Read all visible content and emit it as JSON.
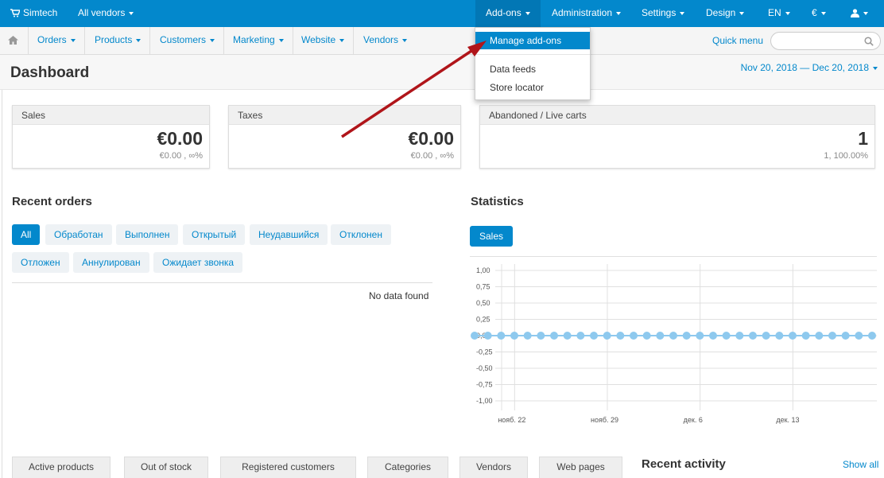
{
  "topbar": {
    "store": "Simtech",
    "vendors": "All vendors",
    "menu": [
      "Add-ons",
      "Administration",
      "Settings",
      "Design",
      "EN",
      "€"
    ]
  },
  "dropdown": {
    "items": [
      "Manage add-ons",
      "Data feeds",
      "Store locator"
    ]
  },
  "subnav": {
    "items": [
      "Orders",
      "Products",
      "Customers",
      "Marketing",
      "Website",
      "Vendors"
    ],
    "quick_menu": "Quick menu"
  },
  "page": {
    "title": "Dashboard",
    "date_range": "Nov 20, 2018 — Dec 20, 2018"
  },
  "cards": [
    {
      "label": "Sales",
      "value": "€0.00",
      "sub": "€0.00 , ∞%"
    },
    {
      "label": "Taxes",
      "value": "€0.00",
      "sub": "€0.00 , ∞%"
    },
    {
      "label": "Abandoned / Live carts",
      "value": "1",
      "sub": "1, 100.00%"
    }
  ],
  "recent_orders": {
    "title": "Recent orders",
    "filters_row1": [
      "All",
      "Обработан",
      "Выполнен",
      "Открытый",
      "Неудавшийся",
      "Отклонен"
    ],
    "filters_row2": [
      "Отложен",
      "Аннулирован",
      "Ожидает звонка"
    ],
    "empty": "No data found"
  },
  "statistics": {
    "title": "Statistics",
    "tab": "Sales"
  },
  "chart_data": {
    "type": "line",
    "title": "",
    "y_ticks": [
      "1,00",
      "0,75",
      "0,50",
      "0,25",
      "0,00",
      "-0,25",
      "-0,50",
      "-0,75",
      "-1,00"
    ],
    "x_ticks": [
      "нояб. 22",
      "нояб. 29",
      "дек. 6",
      "дек. 13"
    ],
    "ylim": [
      -1,
      1
    ],
    "series": [
      {
        "values": [
          0,
          0,
          0,
          0,
          0,
          0,
          0,
          0,
          0,
          0,
          0,
          0,
          0,
          0,
          0,
          0,
          0,
          0,
          0,
          0,
          0,
          0,
          0,
          0,
          0,
          0,
          0,
          0,
          0,
          0,
          0
        ]
      }
    ],
    "color": "#8ec9ee"
  },
  "bottom_tabs": [
    "Active products",
    "Out of stock",
    "Registered customers",
    "Categories",
    "Vendors",
    "Web pages"
  ],
  "recent_activity": {
    "title": "Recent activity",
    "show_all": "Show all"
  }
}
